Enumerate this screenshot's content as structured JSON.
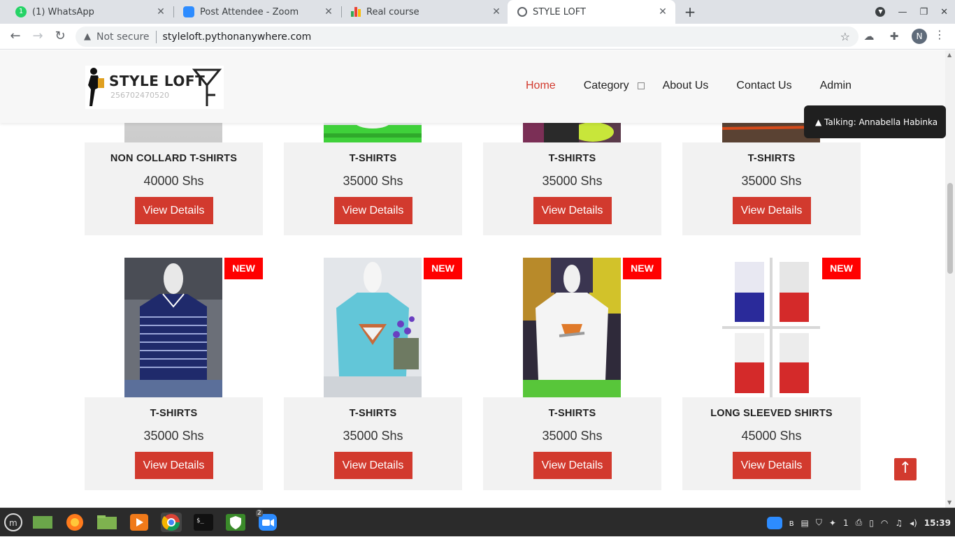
{
  "browser": {
    "tabs": [
      {
        "title": "(1) WhatsApp",
        "icon": "whatsapp-icon",
        "active": false
      },
      {
        "title": "Post Attendee - Zoom",
        "icon": "zoom-icon",
        "active": false
      },
      {
        "title": "Real course",
        "icon": "chart-icon",
        "active": false
      },
      {
        "title": "STYLE LOFT",
        "icon": "globe-icon",
        "active": true
      }
    ],
    "address": {
      "security_text": "Not secure",
      "url": "styleloft.pythonanywhere.com"
    },
    "profile_initial": "N"
  },
  "site": {
    "logo": {
      "text": "STYLE LOFT",
      "phone": "256702470520"
    },
    "nav": [
      {
        "label": "Home",
        "active": true
      },
      {
        "label": "Category",
        "active": false,
        "dropdown": true
      },
      {
        "label": "About Us",
        "active": false
      },
      {
        "label": "Contact Us",
        "active": false
      },
      {
        "label": "Admin",
        "active": false
      }
    ],
    "talking_banner": "▲ Talking: Annabella Habinka",
    "products_row1": [
      {
        "name": "NON COLLARD T-SHIRTS",
        "price": "40000 Shs",
        "button": "View Details"
      },
      {
        "name": "T-SHIRTS",
        "price": "35000 Shs",
        "button": "View Details"
      },
      {
        "name": "T-SHIRTS",
        "price": "35000 Shs",
        "button": "View Details"
      },
      {
        "name": "T-SHIRTS",
        "price": "35000 Shs",
        "button": "View Details"
      }
    ],
    "products_row2": [
      {
        "name": "T-SHIRTS",
        "price": "35000 Shs",
        "button": "View Details",
        "badge": "NEW"
      },
      {
        "name": "T-SHIRTS",
        "price": "35000 Shs",
        "button": "View Details",
        "badge": "NEW"
      },
      {
        "name": "T-SHIRTS",
        "price": "35000 Shs",
        "button": "View Details",
        "badge": "NEW"
      },
      {
        "name": "LONG SLEEVED SHIRTS",
        "price": "45000 Shs",
        "button": "View Details",
        "badge": "NEW"
      }
    ],
    "back_to_top_icon": "arrow-up-icon"
  },
  "taskbar": {
    "zoom_badge": "2",
    "notifications_count": "1",
    "clock": "15:39"
  },
  "colors": {
    "accent_red": "#d23a2e",
    "badge_red": "#ff0000",
    "card_bg": "#f2f2f2"
  }
}
